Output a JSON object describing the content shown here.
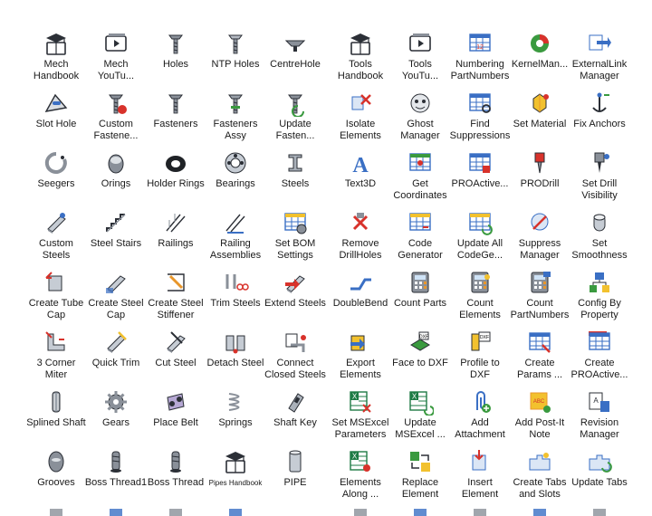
{
  "left_panel": {
    "rows": [
      [
        {
          "label": "Mech\nHandbook",
          "icon": "graduation-cap-book-icon"
        },
        {
          "label": "Mech\nYouTu...",
          "icon": "video-player-icon"
        },
        {
          "label": "Holes",
          "icon": "countersink-hole-icon"
        },
        {
          "label": "NTP Holes",
          "icon": "ntp-hole-icon"
        },
        {
          "label": "CentreHole",
          "icon": "centre-hole-icon"
        }
      ],
      [
        {
          "label": "Slot Hole",
          "icon": "slot-hole-icon"
        },
        {
          "label": "Custom\nFastene...",
          "icon": "custom-fastener-icon"
        },
        {
          "label": "Fasteners",
          "icon": "fasteners-icon"
        },
        {
          "label": "Fasteners\nAssy",
          "icon": "fasteners-assy-icon"
        },
        {
          "label": "Update\nFasten...",
          "icon": "update-fasteners-icon"
        }
      ],
      [
        {
          "label": "Seegers",
          "icon": "seeger-ring-icon"
        },
        {
          "label": "Orings",
          "icon": "oring-icon"
        },
        {
          "label": "Holder Rings",
          "icon": "holder-ring-icon"
        },
        {
          "label": "Bearings",
          "icon": "bearing-icon"
        },
        {
          "label": "Steels",
          "icon": "steel-profile-icon"
        }
      ],
      [
        {
          "label": "Custom\nSteels",
          "icon": "custom-steel-icon"
        },
        {
          "label": "Steel Stairs",
          "icon": "steel-stairs-icon"
        },
        {
          "label": "Railings",
          "icon": "railing-icon"
        },
        {
          "label": "Railing\nAssemblies",
          "icon": "railing-assembly-icon"
        },
        {
          "label": "Set BOM\nSettings",
          "icon": "bom-settings-icon"
        }
      ],
      [
        {
          "label": "Create Tube\nCap",
          "icon": "tube-cap-icon"
        },
        {
          "label": "Create Steel\nCap",
          "icon": "steel-cap-icon"
        },
        {
          "label": "Create Steel\nStiffener",
          "icon": "steel-stiffener-icon"
        },
        {
          "label": "Trim Steels",
          "icon": "trim-steels-icon"
        },
        {
          "label": "Extend Steels",
          "icon": "extend-steels-icon"
        }
      ],
      [
        {
          "label": "3 Corner\nMiter",
          "icon": "corner-miter-icon"
        },
        {
          "label": "Quick Trim",
          "icon": "quick-trim-icon"
        },
        {
          "label": "Cut Steel",
          "icon": "cut-steel-icon"
        },
        {
          "label": "Detach Steel",
          "icon": "detach-steel-icon"
        },
        {
          "label": "Connect\nClosed Steels",
          "icon": "connect-steels-icon"
        }
      ],
      [
        {
          "label": "Splined Shaft",
          "icon": "splined-shaft-icon"
        },
        {
          "label": "Gears",
          "icon": "gear-icon"
        },
        {
          "label": "Place Belt",
          "icon": "belt-icon"
        },
        {
          "label": "Springs",
          "icon": "spring-icon"
        },
        {
          "label": "Shaft Key",
          "icon": "shaft-key-icon"
        }
      ],
      [
        {
          "label": "Grooves",
          "icon": "groove-icon"
        },
        {
          "label": "Boss Thread1",
          "icon": "boss-thread-icon"
        },
        {
          "label": "Boss Thread",
          "icon": "boss-thread-icon"
        },
        {
          "label": "Pipes Handbook",
          "icon": "pipes-handbook-icon",
          "small": true
        },
        {
          "label": "PIPE",
          "icon": "pipe-icon"
        }
      ]
    ]
  },
  "right_panel": {
    "rows": [
      [
        {
          "label": "Tools\nHandbook",
          "icon": "graduation-cap-book-icon"
        },
        {
          "label": "Tools\nYouTu...",
          "icon": "video-player-icon"
        },
        {
          "label": "Numbering\nPartNumbers",
          "icon": "numbering-icon"
        },
        {
          "label": "KernelMan...",
          "icon": "kernel-manager-icon"
        },
        {
          "label": "ExternalLink\nManager",
          "icon": "external-link-icon"
        }
      ],
      [
        {
          "label": "Isolate\nElements",
          "icon": "isolate-icon"
        },
        {
          "label": "Ghost\nManager",
          "icon": "ghost-icon"
        },
        {
          "label": "Find\nSuppressions",
          "icon": "find-suppressions-icon"
        },
        {
          "label": "Set Material",
          "icon": "set-material-icon"
        },
        {
          "label": "Fix Anchors",
          "icon": "fix-anchors-icon"
        }
      ],
      [
        {
          "label": "Text3D",
          "icon": "text3d-icon"
        },
        {
          "label": "Get\nCoordinates",
          "icon": "coordinates-icon"
        },
        {
          "label": "PROActive...",
          "icon": "proactive-icon"
        },
        {
          "label": "PRODrill",
          "icon": "prodrill-icon"
        },
        {
          "label": "Set Drill\nVisibility",
          "icon": "drill-visibility-icon"
        }
      ],
      [
        {
          "label": "Remove\nDrillHoles",
          "icon": "remove-drill-icon"
        },
        {
          "label": "Code\nGenerator",
          "icon": "code-generator-icon"
        },
        {
          "label": "Update All\nCodeGe...",
          "icon": "update-code-icon"
        },
        {
          "label": "Suppress\nManager",
          "icon": "suppress-manager-icon"
        },
        {
          "label": "Set\nSmoothness",
          "icon": "smoothness-icon"
        }
      ],
      [
        {
          "label": "DoubleBend",
          "icon": "double-bend-icon"
        },
        {
          "label": "Count Parts",
          "icon": "count-parts-icon"
        },
        {
          "label": "Count\nElements",
          "icon": "count-elements-icon"
        },
        {
          "label": "Count\nPartNumbers",
          "icon": "count-partnumbers-icon"
        },
        {
          "label": "Config By\nProperty",
          "icon": "config-property-icon"
        }
      ],
      [
        {
          "label": "Export\nElements",
          "icon": "export-elements-icon"
        },
        {
          "label": "Face to DXF",
          "icon": "face-dxf-icon"
        },
        {
          "label": "Profile to\nDXF",
          "icon": "profile-dxf-icon"
        },
        {
          "label": "Create\nParams ...",
          "icon": "create-params-icon"
        },
        {
          "label": "Create\nPROActive...",
          "icon": "create-proactive-icon"
        }
      ],
      [
        {
          "label": "Set MSExcel\nParameters",
          "icon": "excel-params-icon"
        },
        {
          "label": "Update\nMSExcel ...",
          "icon": "excel-update-icon"
        },
        {
          "label": "Add\nAttachment",
          "icon": "attachment-icon"
        },
        {
          "label": "Add Post-It\nNote",
          "icon": "post-it-icon"
        },
        {
          "label": "Revision\nManager",
          "icon": "revision-icon"
        }
      ],
      [
        {
          "label": "Elements\nAlong ...",
          "icon": "elements-along-icon"
        },
        {
          "label": "Replace\nElement",
          "icon": "replace-element-icon"
        },
        {
          "label": "Insert\nElement",
          "icon": "insert-element-icon"
        },
        {
          "label": "Create Tabs\nand Slots",
          "icon": "tabs-slots-icon"
        },
        {
          "label": "Update Tabs",
          "icon": "update-tabs-icon"
        }
      ]
    ]
  },
  "colors": {
    "steel_gray": "#8a9099",
    "dark": "#2b2f36",
    "blue": "#3a6fc4",
    "green": "#3a9a3f",
    "red": "#d8322b",
    "orange": "#e8962b",
    "yellow": "#f2c12e",
    "excel_green": "#1e7b45"
  }
}
